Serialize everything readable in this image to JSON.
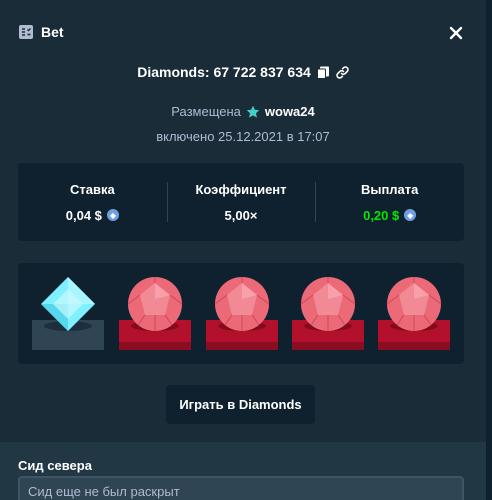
{
  "modal": {
    "title": "Bet",
    "close_icon": "close-icon",
    "title_icon": "bet-slip-icon"
  },
  "game": {
    "id_text": "Diamonds: 67 722 837 634",
    "copy_icon": "copy-icon",
    "link_icon": "link-icon"
  },
  "placed": {
    "label": "Размещена",
    "user": "wowa24",
    "user_icon": "star-icon",
    "date": "включено 25.12.2021 в 17:07"
  },
  "stats": [
    {
      "label": "Ставка",
      "value": "0,04 $",
      "currency_icon": "eth-coin-icon"
    },
    {
      "label": "Коэффициент",
      "value": "5,00×"
    },
    {
      "label": "Выплата",
      "value": "0,20 $",
      "currency_icon": "eth-coin-icon"
    }
  ],
  "colors": {
    "background": "#1a2c38",
    "panel": "#0f212e",
    "payout_green": "#00e701",
    "ruby": "#ec6a78",
    "ruby_base": "#b3112b",
    "diamond": "#7ef0ff"
  },
  "board": {
    "gems": [
      "diamond",
      "ruby",
      "ruby",
      "ruby",
      "ruby"
    ]
  },
  "play_button": {
    "label": "Играть в Diamonds"
  },
  "server_seed": {
    "label": "Сид севера",
    "placeholder": "Сид еще не был раскрыт"
  }
}
